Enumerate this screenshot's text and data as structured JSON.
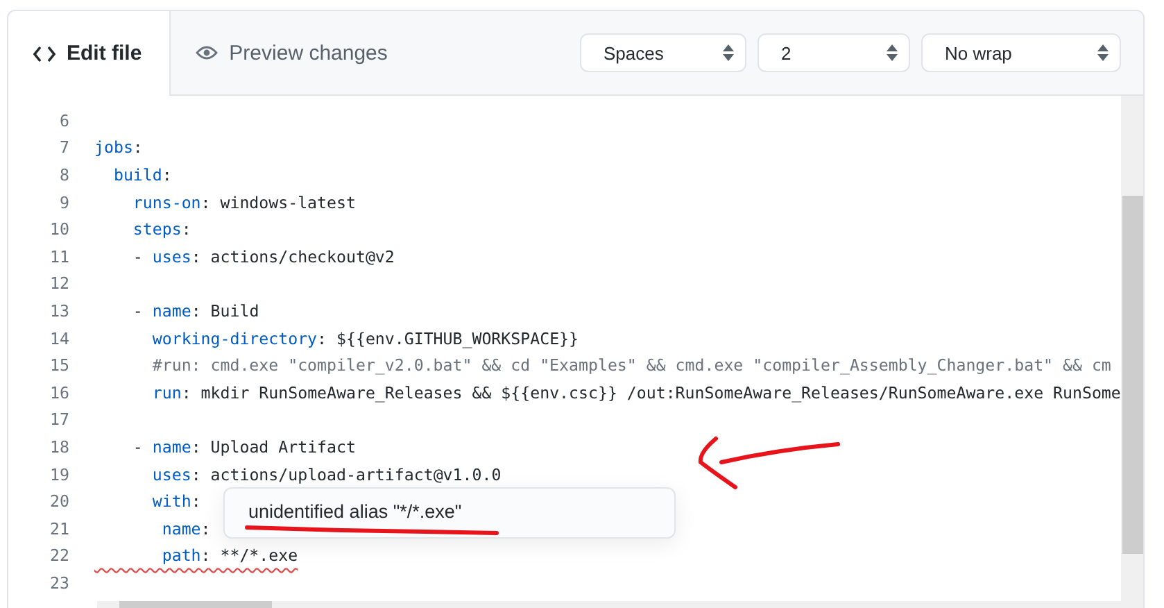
{
  "tabs": [
    {
      "label": "Edit file",
      "selected": true
    },
    {
      "label": "Preview changes",
      "selected": false
    }
  ],
  "selects": [
    {
      "value": "Spaces"
    },
    {
      "value": "2"
    },
    {
      "value": "No wrap"
    }
  ],
  "editor": {
    "lines": [
      {
        "number": "6"
      },
      {
        "number": "7",
        "segments": [
          {
            "kind": "key",
            "text": "jobs"
          },
          {
            "kind": "plain",
            "text": ":"
          }
        ]
      },
      {
        "number": "8",
        "segments": [
          {
            "kind": "key",
            "text": "  build"
          },
          {
            "kind": "plain",
            "text": ":"
          }
        ]
      },
      {
        "number": "9",
        "segments": [
          {
            "kind": "key",
            "text": "    runs-on"
          },
          {
            "kind": "plain",
            "text": ": windows-latest"
          }
        ]
      },
      {
        "number": "10",
        "segments": [
          {
            "kind": "key",
            "text": "    steps"
          },
          {
            "kind": "plain",
            "text": ":"
          }
        ]
      },
      {
        "number": "11",
        "segments": [
          {
            "kind": "plain",
            "text": "    - "
          },
          {
            "kind": "key",
            "text": "uses"
          },
          {
            "kind": "plain",
            "text": ": actions/checkout@v2"
          }
        ]
      },
      {
        "number": "12"
      },
      {
        "number": "13",
        "segments": [
          {
            "kind": "plain",
            "text": "    - "
          },
          {
            "kind": "key",
            "text": "name"
          },
          {
            "kind": "plain",
            "text": ": Build"
          }
        ]
      },
      {
        "number": "14",
        "segments": [
          {
            "kind": "key",
            "text": "      working-directory"
          },
          {
            "kind": "plain",
            "text": ": ${{env.GITHUB_WORKSPACE}}"
          }
        ]
      },
      {
        "number": "15",
        "segments": [
          {
            "kind": "comment",
            "text": "      #run: cmd.exe \"compiler_v2.0.bat\" && cd \"Examples\" && cmd.exe \"compiler_Assembly_Changer.bat\" && cm"
          }
        ]
      },
      {
        "number": "16",
        "segments": [
          {
            "kind": "key",
            "text": "      run"
          },
          {
            "kind": "plain",
            "text": ": mkdir RunSomeAware_Releases && ${{env.csc}} /out:RunSomeAware_Releases/RunSomeAware.exe RunSome"
          }
        ]
      },
      {
        "number": "17"
      },
      {
        "number": "18",
        "segments": [
          {
            "kind": "plain",
            "text": "    - "
          },
          {
            "kind": "key",
            "text": "name"
          },
          {
            "kind": "plain",
            "text": ": Upload Artifact"
          }
        ]
      },
      {
        "number": "19",
        "segments": [
          {
            "kind": "key",
            "text": "      uses"
          },
          {
            "kind": "plain",
            "text": ": actions/upload-artifact@v1.0.0"
          }
        ]
      },
      {
        "number": "20",
        "segments": [
          {
            "kind": "key",
            "text": "      with"
          },
          {
            "kind": "plain",
            "text": ":"
          }
        ]
      },
      {
        "number": "21",
        "segments": [
          {
            "kind": "key",
            "text": "       name"
          },
          {
            "kind": "plain",
            "text": ":"
          }
        ]
      },
      {
        "number": "22",
        "error": true,
        "segments": [
          {
            "kind": "key",
            "text": "       path"
          },
          {
            "kind": "plain",
            "text": ": **/*.exe"
          }
        ]
      },
      {
        "number": "23"
      }
    ],
    "tooltip": {
      "message": "unidentified alias \"*/*.exe\""
    }
  }
}
